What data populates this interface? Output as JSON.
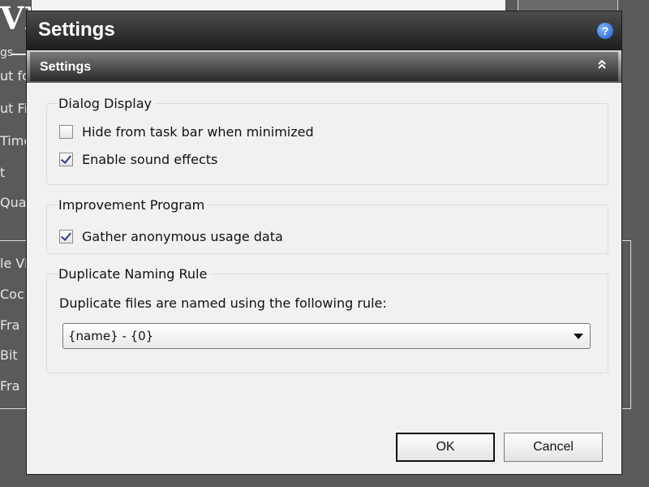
{
  "background": {
    "logo_fragment": "VI",
    "labels": [
      "gs",
      "ut fo",
      "ut Fil",
      "Time",
      "t",
      "Qua",
      "le Vi",
      "Coc",
      "Fra",
      "Bit",
      "Fra"
    ]
  },
  "dialog": {
    "title": "Settings",
    "help_icon": "help-icon",
    "section": {
      "title": "Settings",
      "collapse_icon": "double-chevron-up-icon"
    },
    "groups": {
      "dialog_display": {
        "title": "Dialog Display",
        "options": [
          {
            "label": "Hide from task bar when minimized",
            "checked": false
          },
          {
            "label": "Enable sound effects",
            "checked": true
          }
        ]
      },
      "improvement_program": {
        "title": "Improvement Program",
        "options": [
          {
            "label": "Gather anonymous usage data",
            "checked": true
          }
        ]
      },
      "duplicate_naming": {
        "title": "Duplicate Naming Rule",
        "description": "Duplicate files are named using the following rule:",
        "selected_rule": "{name} - {0}"
      }
    },
    "buttons": {
      "ok": "OK",
      "cancel": "Cancel"
    }
  },
  "colors": {
    "titlebar": "#1d1d1d",
    "dialog_bg": "#f1f1f1",
    "checkmark": "#2b3f8c",
    "help_icon": "#1c5cc4"
  }
}
